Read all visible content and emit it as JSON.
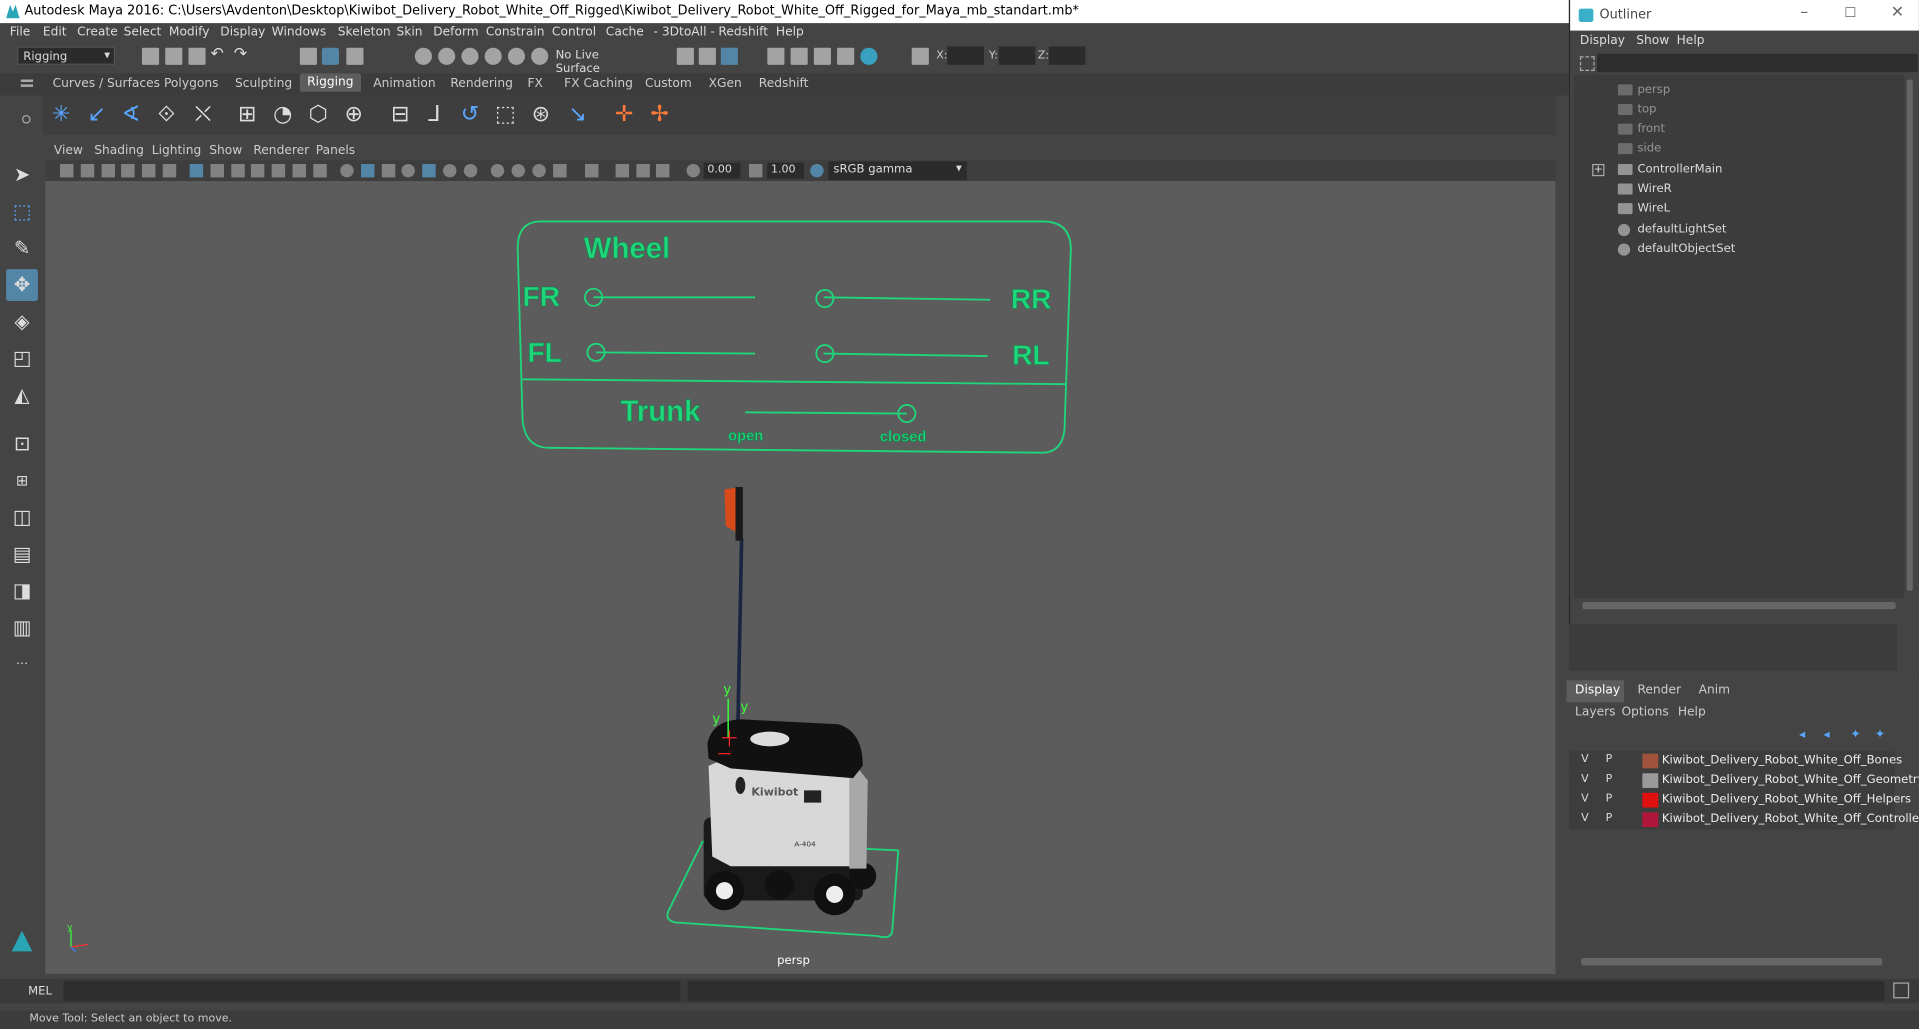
{
  "title": "Autodesk Maya 2016: C:\\Users\\Avdenton\\Desktop\\Kiwibot_Delivery_Robot_White_Off_Rigged\\Kiwibot_Delivery_Robot_White_Off_Rigged_for_Maya_mb_standart.mb*",
  "menu": [
    "File",
    "Edit",
    "Create",
    "Select",
    "Modify",
    "Display",
    "Windows",
    "Skeleton",
    "Skin",
    "Deform",
    "Constrain",
    "Control",
    "Cache",
    "- 3DtoAll -",
    "Redshift",
    "Help"
  ],
  "menuset": "Rigging",
  "live_surface": "No Live Surface",
  "xyz": {
    "x": "X:",
    "y": "Y:",
    "z": "Z:"
  },
  "shelf_tabs": [
    "Curves / Surfaces",
    "Polygons",
    "Sculpting",
    "Rigging",
    "Animation",
    "Rendering",
    "FX",
    "FX Caching",
    "Custom",
    "XGen",
    "Redshift"
  ],
  "active_shelf": "Rigging",
  "panel_menu": [
    "View",
    "Shading",
    "Lighting",
    "Show",
    "Renderer",
    "Panels"
  ],
  "panel_toolbar": {
    "exposure": "0.00",
    "gamma": "1.00",
    "color_space": "sRGB gamma"
  },
  "viewport": {
    "camera_label": "persp",
    "axis_y": "y",
    "controller": {
      "wheel": "Wheel",
      "fr": "FR",
      "rr": "RR",
      "fl": "FL",
      "rl": "RL",
      "trunk": "Trunk",
      "open": "open",
      "closed": "closed"
    },
    "robot_brand": "Kiwibot",
    "robot_id": "A-404",
    "manip_y1": "y",
    "manip_y2": "y",
    "manip_y3": "y"
  },
  "command": {
    "lang": "MEL"
  },
  "help_line": "Move Tool: Select an object to move.",
  "outliner": {
    "title": "Outliner",
    "menu": [
      "Display",
      "Show",
      "Help"
    ],
    "items": [
      "persp",
      "top",
      "front",
      "side",
      "ControllerMain",
      "WireR",
      "WireL",
      "defaultLightSet",
      "defaultObjectSet"
    ]
  },
  "layer_editor": {
    "tabs": [
      "Display",
      "Render",
      "Anim"
    ],
    "menu": [
      "Layers",
      "Options",
      "Help"
    ],
    "layers": [
      {
        "v": "V",
        "p": "P",
        "name": "Kiwibot_Delivery_Robot_White_Off_Bones",
        "color": "#a0523a"
      },
      {
        "v": "V",
        "p": "P",
        "name": "Kiwibot_Delivery_Robot_White_Off_Geometry",
        "color": "#9a9a9a"
      },
      {
        "v": "V",
        "p": "P",
        "name": "Kiwibot_Delivery_Robot_White_Off_Helpers",
        "color": "#e01010"
      },
      {
        "v": "V",
        "p": "P",
        "name": "Kiwibot_Delivery_Robot_White_Off_Controllers",
        "color": "#b0153a"
      }
    ]
  },
  "colors": {
    "controller": "#1fd67a",
    "accent": "#5285a6"
  }
}
